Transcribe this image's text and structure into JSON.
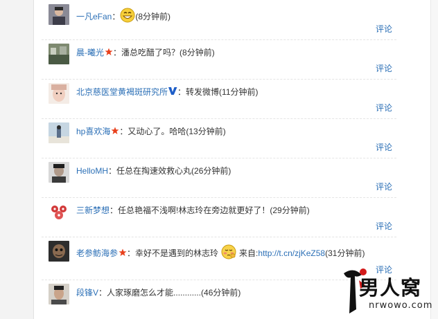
{
  "comments": [
    {
      "author": "一凡eFan",
      "sep": "：",
      "text": "",
      "time": "(8分钟前)",
      "reply": "评论",
      "badge": "none",
      "emoji": "grin",
      "avatar_color": "#6a6a78"
    },
    {
      "author": "晨-曦光",
      "sep": "：",
      "text": "潘总吃醋了吗？",
      "time": "(8分钟前)",
      "reply": "评论",
      "badge": "star",
      "emoji": "none",
      "avatar_color": "#5a6a55"
    },
    {
      "author": "北京慈医堂黄褐斑研究所",
      "sep": "：",
      "text": "转发微博",
      "time": "(11分钟前)",
      "reply": "评论",
      "badge": "v",
      "emoji": "none",
      "avatar_color": "#e8c4b8"
    },
    {
      "author": "hp喜欢海",
      "sep": "：",
      "text": "又动心了。哈哈",
      "time": "(13分钟前)",
      "reply": "评论",
      "badge": "star",
      "emoji": "none",
      "avatar_color": "#b7c9d6"
    },
    {
      "author": "HelloMH",
      "sep": "：",
      "text": "任总在掏速效救心丸",
      "time": "(26分钟前)",
      "reply": "评论",
      "badge": "none",
      "emoji": "none",
      "avatar_color": "#4a4a4a"
    },
    {
      "author": "三新梦想",
      "sep": "：",
      "text": "任总艳福不浅啊!林志玲在旁边就更好了！",
      "time": "(29分钟前)",
      "reply": "评论",
      "badge": "none",
      "emoji": "none",
      "avatar_color": "#d23a3a"
    },
    {
      "author": "老参鲂海参",
      "sep": "：",
      "text": "幸好不是遇到的林志玲",
      "text2": "来自:",
      "link": "http://t.cn/zjKeZ58",
      "time": "(31分钟前)",
      "reply": "评论",
      "badge": "star",
      "emoji": "shy",
      "avatar_color": "#3b3b3b"
    },
    {
      "author": "段锋V",
      "sep": "：",
      "text": "人家琢磨怎么才能............",
      "time": "(46分钟前)",
      "reply": "",
      "badge": "none",
      "emoji": "none",
      "avatar_color": "#6b5a4e"
    }
  ],
  "watermark": {
    "brand": "男人窝",
    "url": "nrwowo.com"
  },
  "colors": {
    "link": "#2b6fb6",
    "text": "#333333",
    "star": "#e8401c",
    "v_badge": "#1e5ec8"
  }
}
